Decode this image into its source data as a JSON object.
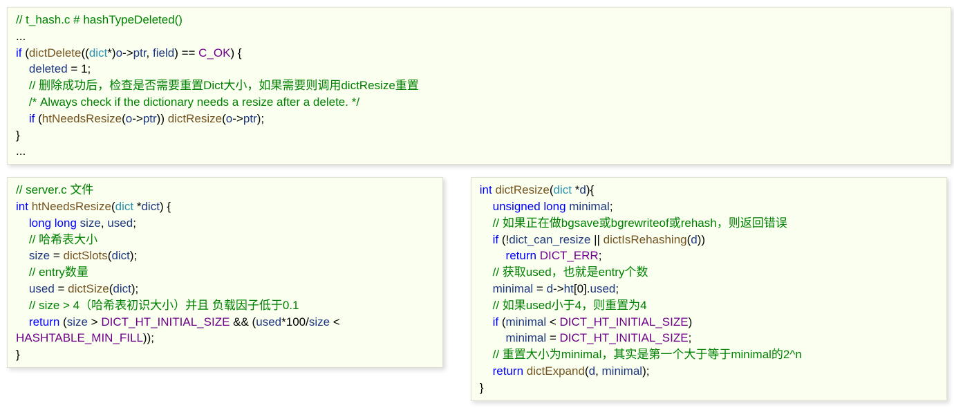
{
  "block1": {
    "l1": "// t_hash.c # hashTypeDeleted()",
    "l2": "...",
    "l3a": "if",
    "l3b": " (",
    "l3c": "dictDelete",
    "l3d": "((",
    "l3e": "dict",
    "l3f": "*)",
    "l3g": "o",
    "l3h": "->",
    "l3i": "ptr",
    "l3j": ", ",
    "l3k": "field",
    "l3l": ") == ",
    "l3m": "C_OK",
    "l3n": ") {",
    "l4pad": "    ",
    "l4a": "deleted",
    "l4b": " = ",
    "l4c": "1",
    "l4d": ";",
    "l5pad": "    ",
    "l5": "// 删除成功后，检查是否需要重置Dict大小，如果需要则调用dictResize重置",
    "l6pad": "    ",
    "l6": "/* Always check if the dictionary needs a resize after a delete. */",
    "l7pad": "    ",
    "l7a": "if",
    "l7b": " (",
    "l7c": "htNeedsResize",
    "l7d": "(",
    "l7e": "o",
    "l7f": "->",
    "l7g": "ptr",
    "l7h": ")) ",
    "l7i": "dictResize",
    "l7j": "(",
    "l7k": "o",
    "l7l": "->",
    "l7m": "ptr",
    "l7n": ");",
    "l8": "}",
    "l9": "..."
  },
  "block2": {
    "l1": "// server.c 文件",
    "l2a": "int",
    "l2b": " ",
    "l2c": "htNeedsResize",
    "l2d": "(",
    "l2e": "dict",
    "l2f": " *",
    "l2g": "dict",
    "l2h": ") {",
    "l3pad": "    ",
    "l3a": "long",
    "l3b": " ",
    "l3c": "long",
    "l3d": " ",
    "l3e": "size",
    "l3f": ", ",
    "l3g": "used",
    "l3h": ";",
    "l4pad": "    ",
    "l4": "// 哈希表大小",
    "l5pad": "    ",
    "l5a": "size",
    "l5b": " = ",
    "l5c": "dictSlots",
    "l5d": "(",
    "l5e": "dict",
    "l5f": ");",
    "l6pad": "    ",
    "l6": "// entry数量",
    "l7pad": "    ",
    "l7a": "used",
    "l7b": " = ",
    "l7c": "dictSize",
    "l7d": "(",
    "l7e": "dict",
    "l7f": ");",
    "l8pad": "    ",
    "l8": "// size > 4（哈希表初识大小）并且 负载因子低于0.1",
    "l9pad": "    ",
    "l9a": "return",
    "l9b": " (",
    "l9c": "size",
    "l9d": " > ",
    "l9e": "DICT_HT_INITIAL_SIZE",
    "l9f": " && (",
    "l9g": "used",
    "l9h": "*",
    "l9i": "100",
    "l9j": "/",
    "l9k": "size",
    "l9l": " < ",
    "l10a": "HASHTABLE_MIN_FILL",
    "l10b": "));",
    "l11": "}"
  },
  "block3": {
    "l1a": "int",
    "l1b": " ",
    "l1c": "dictResize",
    "l1d": "(",
    "l1e": "dict",
    "l1f": " *",
    "l1g": "d",
    "l1h": "){",
    "l2pad": "    ",
    "l2a": "unsigned",
    "l2b": " ",
    "l2c": "long",
    "l2d": " ",
    "l2e": "minimal",
    "l2f": ";",
    "l3pad": "    ",
    "l3": "// 如果正在做bgsave或bgrewriteof或rehash，则返回错误",
    "l4pad": "    ",
    "l4a": "if",
    "l4b": " (!",
    "l4c": "dict_can_resize",
    "l4d": " || ",
    "l4e": "dictIsRehashing",
    "l4f": "(",
    "l4g": "d",
    "l4h": "))",
    "l5pad": "        ",
    "l5a": "return",
    "l5b": " ",
    "l5c": "DICT_ERR",
    "l5d": ";",
    "l6pad": "    ",
    "l6": "// 获取used，也就是entry个数",
    "l7pad": "    ",
    "l7a": "minimal",
    "l7b": " = ",
    "l7c": "d",
    "l7d": "->",
    "l7e": "ht",
    "l7f": "[",
    "l7g": "0",
    "l7h": "].",
    "l7i": "used",
    "l7j": ";",
    "l8pad": "    ",
    "l8": "// 如果used小于4，则重置为4",
    "l9pad": "    ",
    "l9a": "if",
    "l9b": " (",
    "l9c": "minimal",
    "l9d": " < ",
    "l9e": "DICT_HT_INITIAL_SIZE",
    "l9f": ")",
    "l10pad": "        ",
    "l10a": "minimal",
    "l10b": " = ",
    "l10c": "DICT_HT_INITIAL_SIZE",
    "l10d": ";",
    "l11pad": "    ",
    "l11": "// 重置大小为minimal，其实是第一个大于等于minimal的2^n",
    "l12pad": "    ",
    "l12a": "return",
    "l12b": " ",
    "l12c": "dictExpand",
    "l12d": "(",
    "l12e": "d",
    "l12f": ", ",
    "l12g": "minimal",
    "l12h": ");",
    "l13": "}"
  }
}
